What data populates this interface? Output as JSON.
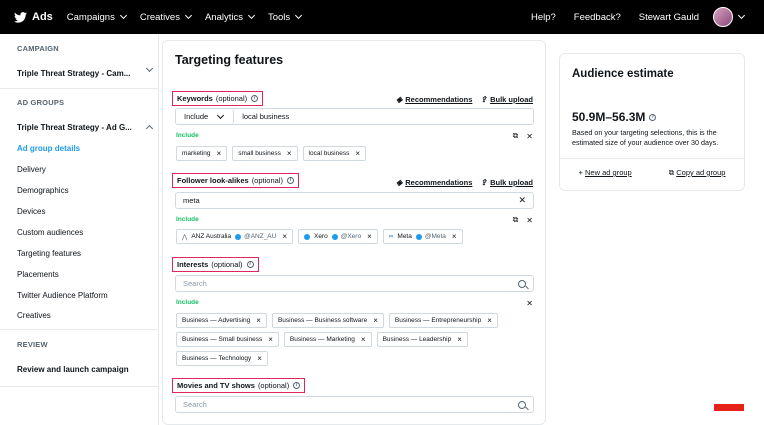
{
  "topbar": {
    "logo_text": "Ads",
    "nav": [
      "Campaigns",
      "Creatives",
      "Analytics",
      "Tools"
    ],
    "help": "Help?",
    "feedback": "Feedback?",
    "user": "Stewart Gauld"
  },
  "sidebar": {
    "campaign_header": "CAMPAIGN",
    "campaign_name": "Triple Threat Strategy - Cam...",
    "adgroups_header": "AD GROUPS",
    "adgroup_name": "Triple Threat Strategy - Ad G...",
    "items": [
      "Ad group details",
      "Delivery",
      "Demographics",
      "Devices",
      "Custom audiences",
      "Targeting features",
      "Placements",
      "Twitter Audience Platform",
      "Creatives"
    ],
    "review_header": "REVIEW",
    "review_item": "Review and launch campaign"
  },
  "main": {
    "title": "Targeting features",
    "recommendations": "Recommendations",
    "bulk_upload": "Bulk upload",
    "optional": "(optional)",
    "include_label": "Include",
    "keywords": {
      "label": "Keywords",
      "select_value": "Include",
      "input_value": "local business",
      "chips": [
        "marketing",
        "small business",
        "local business"
      ]
    },
    "followers": {
      "label": "Follower look-alikes",
      "input_value": "meta",
      "chips": [
        {
          "name": "ANZ Australia",
          "handle": "@ANZ_AU"
        },
        {
          "name": "Xero",
          "handle": "@Xero"
        },
        {
          "name": "Meta",
          "handle": "@Meta"
        }
      ]
    },
    "interests": {
      "label": "Interests",
      "placeholder": "Search",
      "chips": [
        "Business — Advertising",
        "Business — Business software",
        "Business — Entrepreneurship",
        "Business — Small business",
        "Business — Marketing",
        "Business — Leadership",
        "Business — Technology"
      ]
    },
    "movies": {
      "label": "Movies and TV shows",
      "placeholder": "Search"
    }
  },
  "audience": {
    "title": "Audience estimate",
    "range": "50.9M–56.3M",
    "description": "Based on your targeting selections, this is the estimated size of your audience over 30 days.",
    "new_ad_group": "New ad group",
    "copy_ad_group": "Copy ad group"
  },
  "colors": {
    "accent": "#1d9bf0",
    "highlight": "#e0245e",
    "include_green": "#17bf63"
  }
}
